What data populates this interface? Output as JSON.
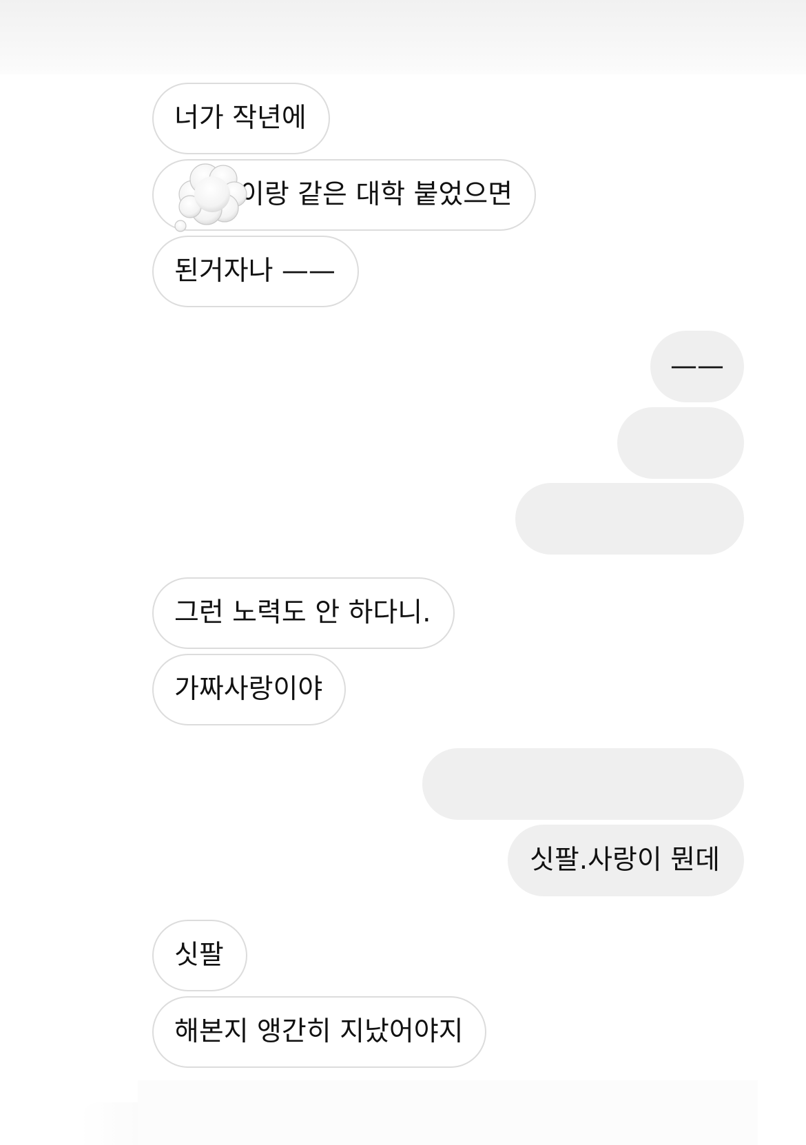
{
  "messages": [
    {
      "side": "in",
      "text": "너가 작년에"
    },
    {
      "side": "in",
      "text": "이랑 같은 대학 붙었으면"
    },
    {
      "side": "in",
      "text": "된거자나 ——"
    },
    {
      "side": "out",
      "text": "——"
    },
    {
      "side": "out",
      "text": ""
    },
    {
      "side": "out",
      "text": ""
    },
    {
      "side": "in",
      "text": "그런 노력도 안 하다니."
    },
    {
      "side": "in",
      "text": "가짜사랑이야"
    },
    {
      "side": "out",
      "text": ""
    },
    {
      "side": "out",
      "text": "싯팔.사랑이 뭔데"
    },
    {
      "side": "in",
      "text": "싯팔"
    },
    {
      "side": "in",
      "text": "해본지 앵간히 지났어야지"
    }
  ],
  "redaction": {
    "icon": "thought-bubble-cloud-icon"
  },
  "colors": {
    "incoming_bg": "#ffffff",
    "incoming_border": "#dcdcdc",
    "outgoing_bg": "#efefef",
    "text": "#111111"
  }
}
